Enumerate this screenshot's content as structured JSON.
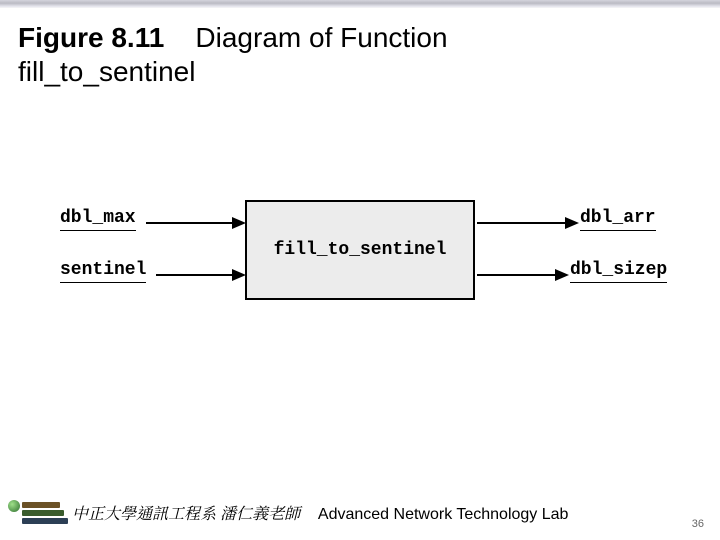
{
  "title": {
    "line1_prefix": "Figure 8.11",
    "line1_rest": "Diagram of Function",
    "line2": "fill_to_sentinel"
  },
  "diagram": {
    "function_name": "fill_to_sentinel",
    "inputs": [
      "dbl_max",
      "sentinel"
    ],
    "outputs": [
      "dbl_arr",
      "dbl_sizep"
    ]
  },
  "footer": {
    "org_cn": "中正大學通訊工程系 潘仁義老師",
    "lab_en": "Advanced Network Technology Lab"
  },
  "page_number": "36"
}
